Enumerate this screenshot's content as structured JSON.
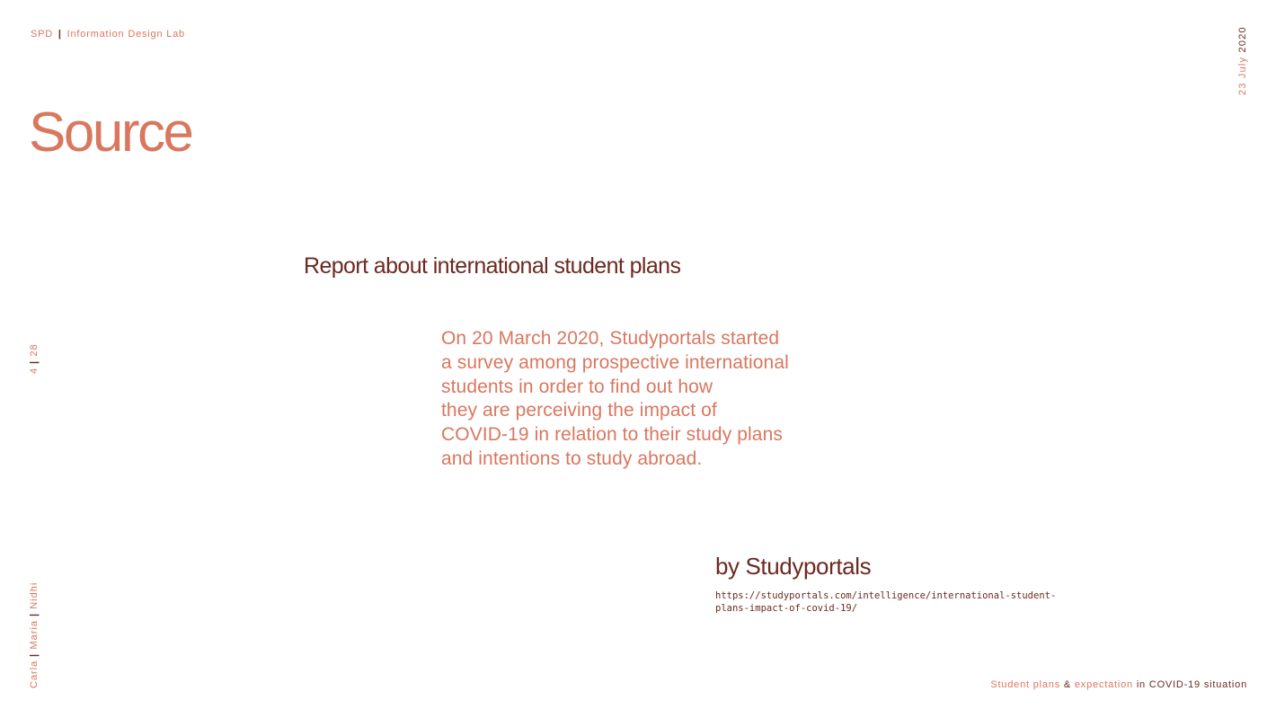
{
  "header": {
    "org": "SPD",
    "separator": "|",
    "lab": "Information Design Lab"
  },
  "date": {
    "day_month": "23 July",
    "year": "2020"
  },
  "pagination": {
    "current": "4",
    "separator": "|",
    "total": "28"
  },
  "authors": {
    "items": [
      "Carla",
      "Maria",
      "Nidhi"
    ],
    "separator": "|"
  },
  "title": "Source",
  "report_heading": "Report about international student plans",
  "body_lines": [
    "On 20 March 2020, Studyportals started",
    "a survey among prospective international",
    "students in order to find out how",
    "they are perceiving the impact of",
    "COVID-19 in relation to their study plans",
    "and intentions to study abroad."
  ],
  "source": {
    "name": "by Studyportals",
    "url_lines": [
      "https://studyportals.com/intelligence/international-student-",
      "plans-impact-of-covid-19/"
    ]
  },
  "footer": {
    "part1": "Student plans",
    "amp": "&",
    "part2": "expectation",
    "part3": "in COVID-19 situation"
  },
  "colors": {
    "accent": "#d9775f",
    "dark": "#6b2a22",
    "background": "#ffffff"
  }
}
